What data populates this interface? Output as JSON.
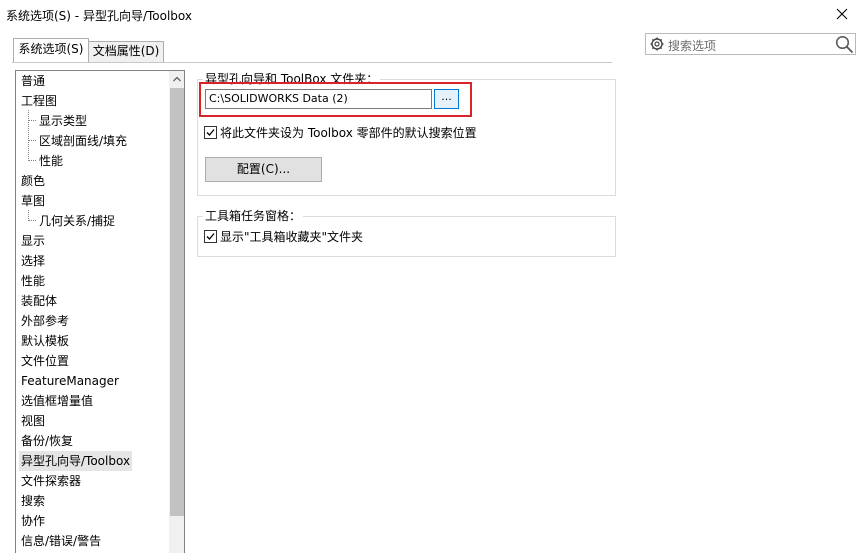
{
  "window": {
    "title": "系统选项(S) - 异型孔向导/Toolbox"
  },
  "tabs": [
    {
      "label": "系统选项(S)"
    },
    {
      "label": "文档属性(D)"
    }
  ],
  "search": {
    "placeholder": "搜索选项"
  },
  "tree": {
    "items": [
      {
        "label": "普通"
      },
      {
        "label": "工程图"
      },
      {
        "label": "显示类型"
      },
      {
        "label": "区域剖面线/填充"
      },
      {
        "label": "性能"
      },
      {
        "label": "颜色"
      },
      {
        "label": "草图"
      },
      {
        "label": "几何关系/捕捉"
      },
      {
        "label": "显示"
      },
      {
        "label": "选择"
      },
      {
        "label": "性能"
      },
      {
        "label": "装配体"
      },
      {
        "label": "外部参考"
      },
      {
        "label": "默认模板"
      },
      {
        "label": "文件位置"
      },
      {
        "label": "FeatureManager"
      },
      {
        "label": "选值框增量值"
      },
      {
        "label": "视图"
      },
      {
        "label": "备份/恢复"
      },
      {
        "label": "异型孔向导/Toolbox"
      },
      {
        "label": "文件探索器"
      },
      {
        "label": "搜索"
      },
      {
        "label": "协作"
      },
      {
        "label": "信息/错误/警告"
      }
    ]
  },
  "toolbox_group": {
    "label": "异型孔向导和 ToolBox 文件夹：",
    "path_value": "C:\\SOLIDWORKS Data (2)",
    "browse_label": "...",
    "default_search_checkbox": {
      "label": "将此文件夹设为 Toolbox 零部件的默认搜索位置",
      "checked": true
    },
    "config_button": "配置(C)..."
  },
  "taskpane_group": {
    "label": "工具箱任务窗格：",
    "show_favorites_checkbox": {
      "label": "显示\"工具箱收藏夹\"文件夹",
      "checked": true
    }
  }
}
